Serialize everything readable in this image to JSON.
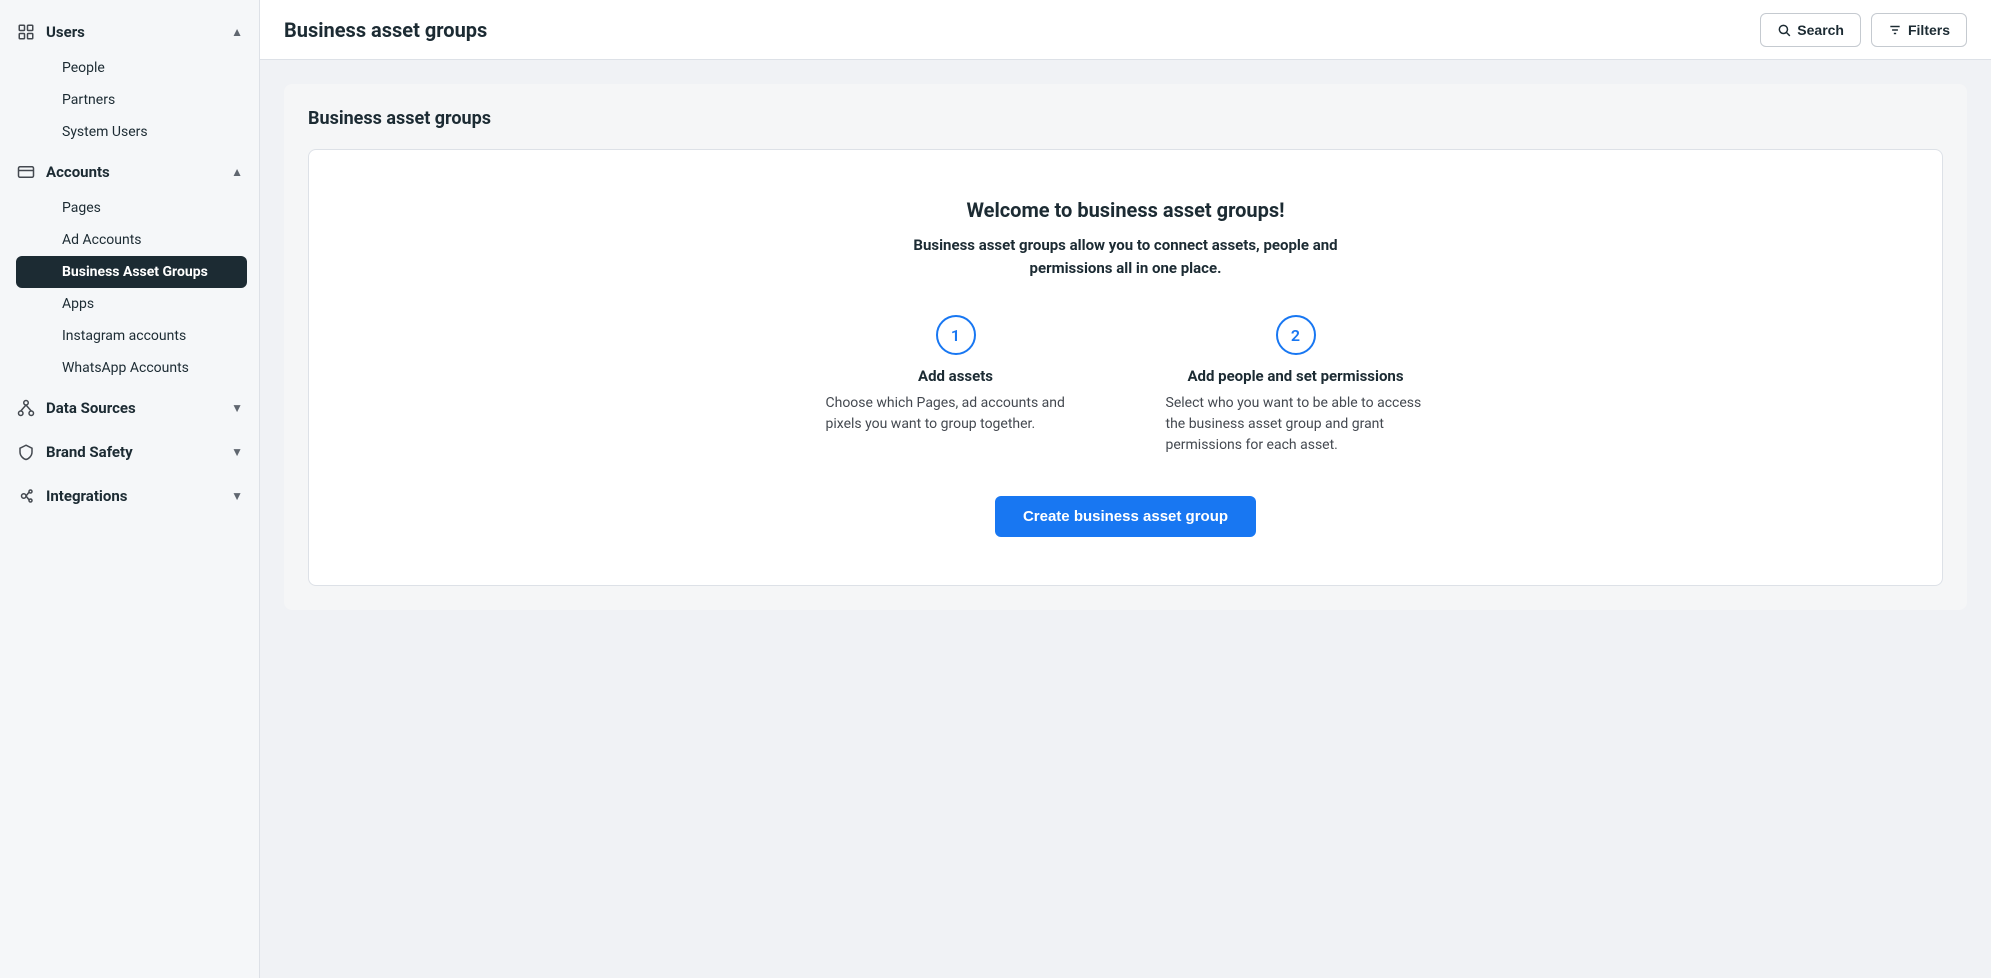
{
  "sidebar": {
    "sections": [
      {
        "id": "users",
        "label": "Users",
        "icon": "users-icon",
        "expanded": true,
        "items": [
          {
            "id": "people",
            "label": "People",
            "active": false
          },
          {
            "id": "partners",
            "label": "Partners",
            "active": false
          },
          {
            "id": "system-users",
            "label": "System Users",
            "active": false
          }
        ]
      },
      {
        "id": "accounts",
        "label": "Accounts",
        "icon": "accounts-icon",
        "expanded": true,
        "items": [
          {
            "id": "pages",
            "label": "Pages",
            "active": false
          },
          {
            "id": "ad-accounts",
            "label": "Ad Accounts",
            "active": false
          },
          {
            "id": "business-asset-groups",
            "label": "Business Asset Groups",
            "active": true
          },
          {
            "id": "apps",
            "label": "Apps",
            "active": false
          },
          {
            "id": "instagram-accounts",
            "label": "Instagram accounts",
            "active": false
          },
          {
            "id": "whatsapp-accounts",
            "label": "WhatsApp Accounts",
            "active": false
          }
        ]
      },
      {
        "id": "data-sources",
        "label": "Data Sources",
        "icon": "data-sources-icon",
        "expanded": false,
        "items": []
      },
      {
        "id": "brand-safety",
        "label": "Brand Safety",
        "icon": "brand-safety-icon",
        "expanded": false,
        "items": []
      },
      {
        "id": "integrations",
        "label": "Integrations",
        "icon": "integrations-icon",
        "expanded": false,
        "items": []
      }
    ]
  },
  "header": {
    "page_title": "Business asset groups",
    "search_label": "Search",
    "filters_label": "Filters"
  },
  "content": {
    "panel_title": "Business asset groups",
    "welcome": {
      "title": "Welcome to business asset groups!",
      "subtitle": "Business asset groups allow you to connect assets, people and permissions all in one place.",
      "steps": [
        {
          "number": "1",
          "title": "Add assets",
          "description": "Choose which Pages, ad accounts and pixels you want to group together."
        },
        {
          "number": "2",
          "title": "Add people and set permissions",
          "description": "Select who you want to be able to access the business asset group and grant permissions for each asset."
        }
      ],
      "cta_label": "Create business asset group"
    }
  }
}
